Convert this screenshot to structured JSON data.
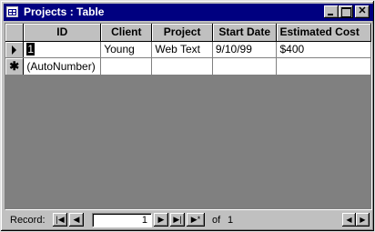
{
  "window": {
    "title": "Projects : Table",
    "minimize_glyph": "_",
    "maximize_glyph": "□",
    "close_glyph": "✕"
  },
  "table": {
    "columns": [
      "ID",
      "Client",
      "Project",
      "Start Date",
      "Estimated Cost"
    ],
    "rows": [
      {
        "id": "1",
        "client": "Young",
        "project": "Web Text",
        "start_date": "9/10/99",
        "estimated_cost": "$400"
      }
    ],
    "new_row": {
      "id": "(AutoNumber)"
    }
  },
  "statusbar": {
    "record_label": "Record:",
    "current_record": "1",
    "of_label": "of",
    "total_records": "1",
    "first_glyph": "|◀",
    "prev_glyph": "◀",
    "next_glyph": "▶",
    "last_glyph": "▶|",
    "new_glyph": "▶*",
    "scroll_left_glyph": "◀",
    "scroll_right_glyph": "▶"
  }
}
